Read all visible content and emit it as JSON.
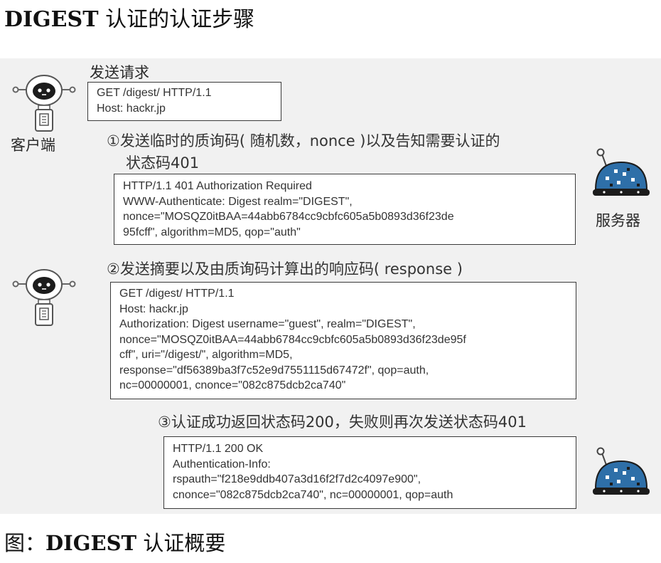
{
  "title": {
    "bold": "DIGEST",
    "rest": " 认证的认证步骤"
  },
  "request_label": "发送请求",
  "client_label": "客户端",
  "server_label": "服务器",
  "box_request": [
    "GET /digest/ HTTP/1.1",
    "Host: hackr.jp"
  ],
  "step1": [
    "①发送临时的质询码( 随机数，nonce )以及告知需要认证的",
    "状态码401"
  ],
  "box_step1": [
    "HTTP/1.1 401 Authorization Required",
    "WWW-Authenticate: Digest realm=\"DIGEST\",",
    "nonce=\"MOSQZ0itBAA=44abb6784cc9cbfc605a5b0893d36f23de",
    "95fcff\", algorithm=MD5, qop=\"auth\""
  ],
  "step2": "②发送摘要以及由质询码计算出的响应码( response )",
  "box_step2": [
    "GET /digest/ HTTP/1.1",
    "Host: hackr.jp",
    "Authorization: Digest username=\"guest\", realm=\"DIGEST\",",
    "nonce=\"MOSQZ0itBAA=44abb6784cc9cbfc605a5b0893d36f23de95f",
    "cff\", uri=\"/digest/\", algorithm=MD5,",
    "response=\"df56389ba3f7c52e9d7551115d67472f\", qop=auth,",
    "nc=00000001, cnonce=\"082c875dcb2ca740\""
  ],
  "step3": "③认证成功返回状态码200，失败则再次发送状态码401",
  "box_step3": [
    "HTTP/1.1 200 OK",
    "Authentication-Info:",
    "rspauth=\"f218e9ddb407a3d16f2f7d2c4097e900\",",
    "cnonce=\"082c875dcb2ca740\", nc=00000001, qop=auth"
  ],
  "caption": {
    "prefix": "图：",
    "bold": "DIGEST",
    "rest": " 认证概要"
  },
  "colors": {
    "panel": "#f1f1f1",
    "robot_blue": "#2e6fa8",
    "robot_dark": "#1c1c1c",
    "ink": "#333333"
  }
}
